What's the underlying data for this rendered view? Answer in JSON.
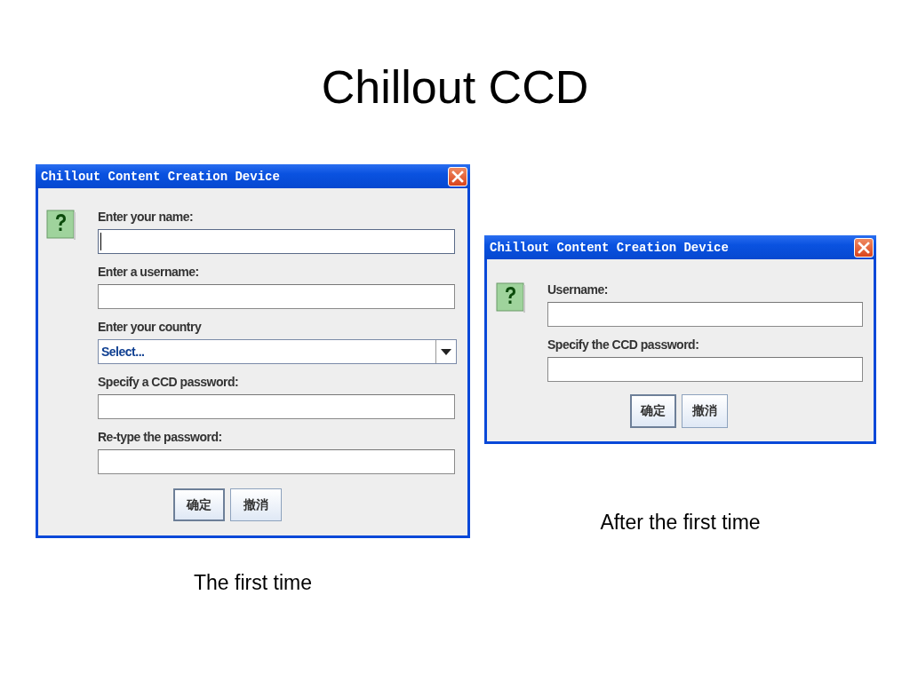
{
  "title": "Chillout CCD",
  "dialogs": [
    {
      "window": {
        "title": "Chillout Content Creation Device"
      },
      "fields": [
        {
          "kind": "text",
          "label": "Enter your name:",
          "focused": true
        },
        {
          "kind": "text",
          "label": "Enter a username:",
          "focused": false
        },
        {
          "kind": "combo",
          "label": "Enter your country",
          "value": "Select...",
          "focused": false
        },
        {
          "kind": "text",
          "label": "Specify a CCD password:",
          "focused": false
        },
        {
          "kind": "text",
          "label": "Re-type the password:",
          "focused": false
        }
      ],
      "buttons": [
        {
          "label": "确定",
          "default": true
        },
        {
          "label": "撤消",
          "default": false
        }
      ],
      "caption": "The first time"
    },
    {
      "window": {
        "title": "Chillout Content Creation Device"
      },
      "fields": [
        {
          "kind": "text",
          "label": "Username:",
          "focused": false
        },
        {
          "kind": "text",
          "label": "Specify the CCD password:",
          "focused": false
        }
      ],
      "buttons": [
        {
          "label": "确定",
          "default": true
        },
        {
          "label": "撤消",
          "default": false
        }
      ],
      "caption": "After the first time"
    }
  ]
}
